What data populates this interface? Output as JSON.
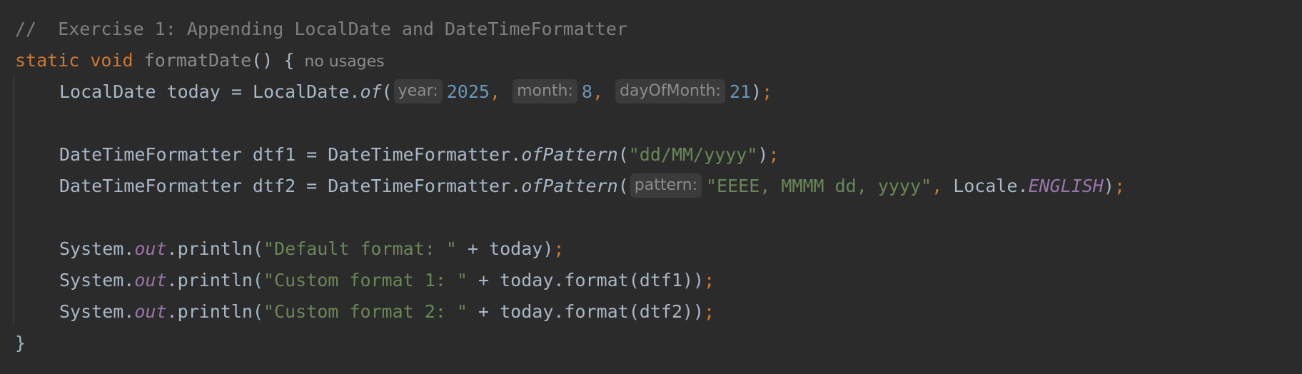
{
  "editor": {
    "line1": {
      "comment": "//  Exercise 1: Appending LocalDate and DateTimeFormatter"
    },
    "line2": {
      "kw_static": "static",
      "kw_void": "void",
      "method_name": "formatDate",
      "paren_brace": "() {",
      "usages_hint": "no usages"
    },
    "line3": {
      "decl": "LocalDate today = LocalDate.",
      "method": "of",
      "open": "(",
      "hint_year": "year:",
      "year": "2025",
      "comma1": ",",
      "hint_month": "month:",
      "month": "8",
      "comma2": ",",
      "hint_day": "dayOfMonth:",
      "day": "21",
      "close": ")",
      "semi": ";"
    },
    "line5": {
      "decl": "DateTimeFormatter dtf1 = DateTimeFormatter.",
      "method": "ofPattern",
      "open": "(",
      "str": "\"dd/MM/yyyy\"",
      "close": ")",
      "semi": ";"
    },
    "line6": {
      "decl": "DateTimeFormatter dtf2 = DateTimeFormatter.",
      "method": "ofPattern",
      "open": "(",
      "hint_pattern": "pattern:",
      "str": "\"EEEE, MMMM dd, yyyy\"",
      "comma": ",",
      "locale": " Locale.",
      "locale_field": "ENGLISH",
      "close": ")",
      "semi": ";"
    },
    "line8": {
      "system": "System.",
      "out": "out",
      "call": ".println(",
      "str": "\"Default format: \"",
      "rest": " + today)",
      "semi": ";"
    },
    "line9": {
      "system": "System.",
      "out": "out",
      "call": ".println(",
      "str": "\"Custom format 1: \"",
      "rest": " + today.format(dtf1))",
      "semi": ";"
    },
    "line10": {
      "system": "System.",
      "out": "out",
      "call": ".println(",
      "str": "\"Custom format 2: \"",
      "rest": " + today.format(dtf2))",
      "semi": ";"
    },
    "line11": {
      "brace": "}"
    }
  }
}
